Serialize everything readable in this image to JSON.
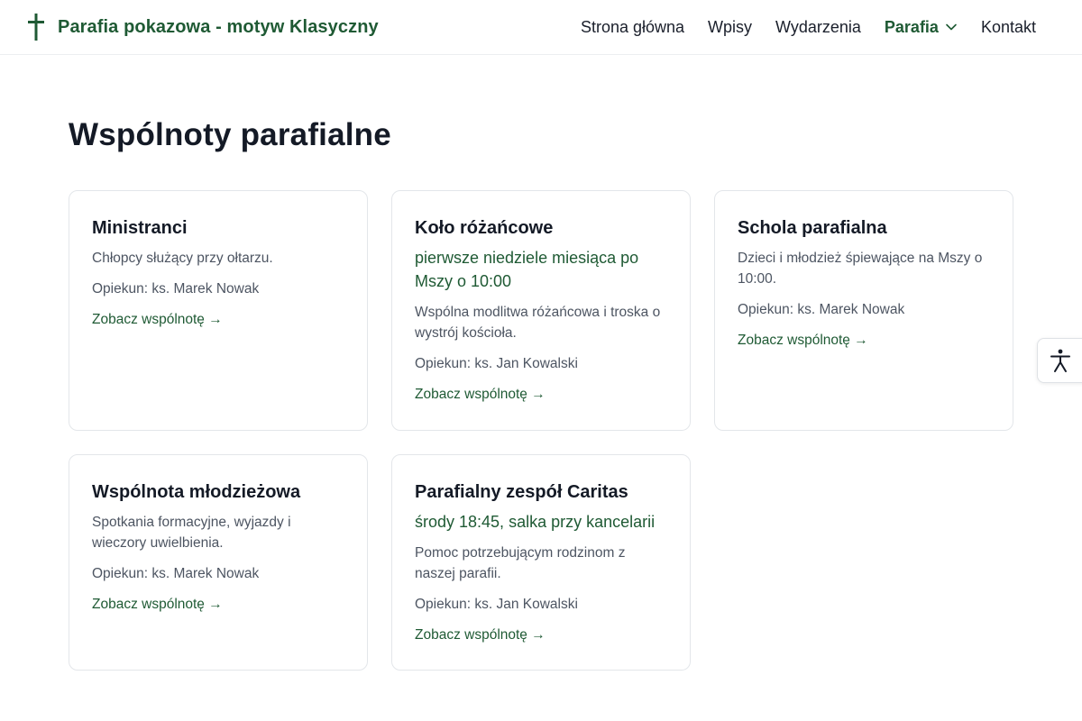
{
  "header": {
    "site_name": "Parafia pokazowa - motyw Klasyczny",
    "nav": [
      {
        "label": "Strona główna"
      },
      {
        "label": "Wpisy"
      },
      {
        "label": "Wydarzenia"
      },
      {
        "label": "Parafia",
        "active": true,
        "has_dropdown": true
      },
      {
        "label": "Kontakt"
      }
    ]
  },
  "main": {
    "title": "Wspólnoty parafialne",
    "cards": [
      {
        "title": "Ministranci",
        "meta": "",
        "description": "Chłopcy służący przy ołtarzu.",
        "keeper": "Opiekun: ks. Marek Nowak",
        "link": "Zobacz wspólnotę →"
      },
      {
        "title": "Koło różańcowe",
        "meta": "pierwsze niedziele miesiąca po Mszy o 10:00",
        "description": "Wspólna modlitwa różańcowa i troska o wystrój kościoła.",
        "keeper": "Opiekun: ks. Jan Kowalski",
        "link": "Zobacz wspólnotę →"
      },
      {
        "title": "Schola parafialna",
        "meta": "",
        "description": "Dzieci i młodzież śpiewające na Mszy o 10:00.",
        "keeper": "Opiekun: ks. Marek Nowak",
        "link": "Zobacz wspólnotę →"
      },
      {
        "title": "Wspólnota młodzieżowa",
        "meta": "",
        "description": "Spotkania formacyjne, wyjazdy i wieczory uwielbienia.",
        "keeper": "Opiekun: ks. Marek Nowak",
        "link": "Zobacz wspólnotę →"
      },
      {
        "title": "Parafialny zespół Caritas",
        "meta": "środy 18:45, salka przy kancelarii",
        "description": "Pomoc potrzebującym rodzinom z naszej parafii.",
        "keeper": "Opiekun: ks. Jan Kowalski",
        "link": "Zobacz wspólnotę →"
      }
    ]
  },
  "icons": {
    "logo": "cross-icon",
    "dropdown": "chevron-down-icon",
    "accessibility": "accessibility-icon"
  },
  "colors": {
    "accent": "#1f5a34",
    "text": "#141a26",
    "muted": "#4d5562",
    "border": "#e3e6ea"
  }
}
